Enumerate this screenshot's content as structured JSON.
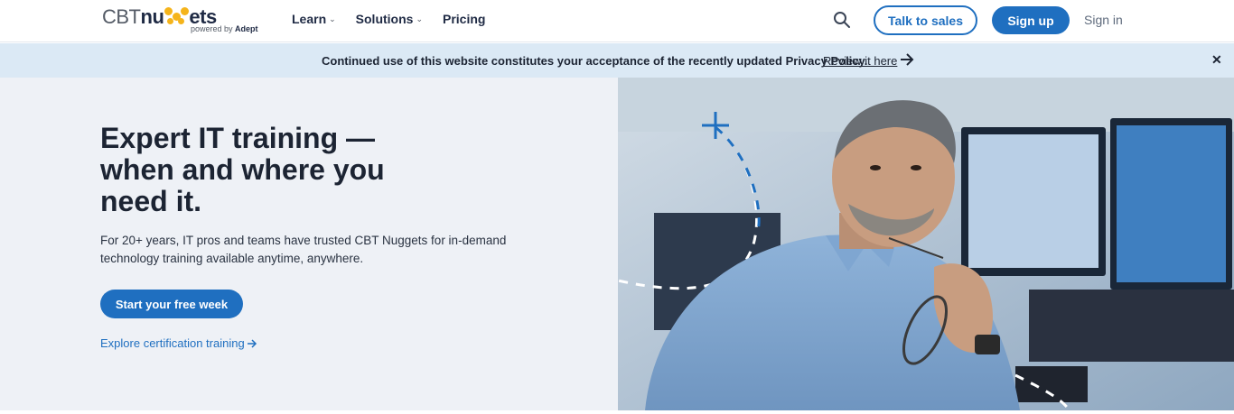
{
  "header": {
    "logo": {
      "brand_left": "CBT",
      "brand_mid": "nu",
      "brand_right": "ets",
      "sub_prefix": "powered by",
      "sub_brand": "Adept"
    },
    "nav": [
      {
        "label": "Learn",
        "has_dropdown": true
      },
      {
        "label": "Solutions",
        "has_dropdown": true
      },
      {
        "label": "Pricing",
        "has_dropdown": false
      }
    ],
    "search_icon": "search-icon",
    "talk_to_sales": "Talk to sales",
    "sign_up": "Sign up",
    "sign_in": "Sign in"
  },
  "banner": {
    "text": "Continued use of this website constitutes your acceptance of the recently updated Privacy Policy.",
    "link": "Review it here",
    "close": "✕"
  },
  "hero": {
    "title": "Expert IT training — when and where you need it.",
    "description": "For 20+ years, IT pros and teams have trusted CBT Nuggets for in-demand technology training available anytime, anywhere.",
    "cta": "Start your free week",
    "secondary_link": "Explore certification training"
  },
  "colors": {
    "brand_blue": "#1f6fc0",
    "banner_bg": "#dbe9f5",
    "hero_bg": "#eef1f6",
    "logo_yellow": "#f5b41b"
  }
}
